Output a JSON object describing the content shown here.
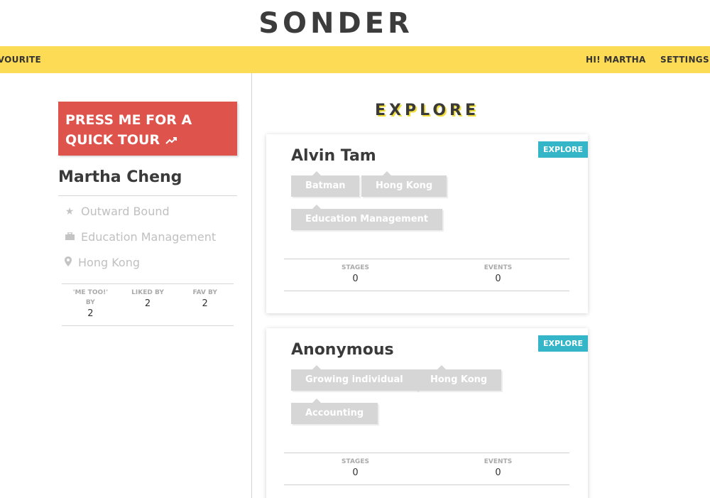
{
  "brand": "SONDER",
  "nav": {
    "favourite": "AVOURITE",
    "greeting": "HI! MARTHA",
    "settings": "SETTINGS"
  },
  "sidebar": {
    "tour_button": "PRESS ME FOR A QUICK TOUR",
    "profile_name": "Martha Cheng",
    "info": [
      {
        "icon": "star-icon",
        "text": "Outward Bound"
      },
      {
        "icon": "briefcase-icon",
        "text": "Education Management"
      },
      {
        "icon": "map-pin-icon",
        "text": "Hong Kong"
      }
    ],
    "stats": [
      {
        "label": "'ME TOO!' BY",
        "value": "2"
      },
      {
        "label": "LIKED BY",
        "value": "2"
      },
      {
        "label": "FAV BY",
        "value": "2"
      }
    ]
  },
  "main": {
    "title": "EXPLORE",
    "cards": [
      {
        "name": "Alvin Tam",
        "badge": "EXPLORE",
        "tags": [
          "Batman",
          "Hong Kong",
          "Education Management"
        ],
        "stats": [
          {
            "label": "STAGES",
            "value": "0"
          },
          {
            "label": "EVENTS",
            "value": "0"
          }
        ]
      },
      {
        "name": "Anonymous",
        "badge": "EXPLORE",
        "tags": [
          "Growing individual",
          "Hong Kong",
          "Accounting"
        ],
        "stats": [
          {
            "label": "STAGES",
            "value": "0"
          },
          {
            "label": "EVENTS",
            "value": "0"
          }
        ]
      }
    ]
  },
  "colors": {
    "navbar": "#fedb55",
    "tour_button": "#de544d",
    "badge": "#35b6c8",
    "tag": "#d6d6d6"
  }
}
